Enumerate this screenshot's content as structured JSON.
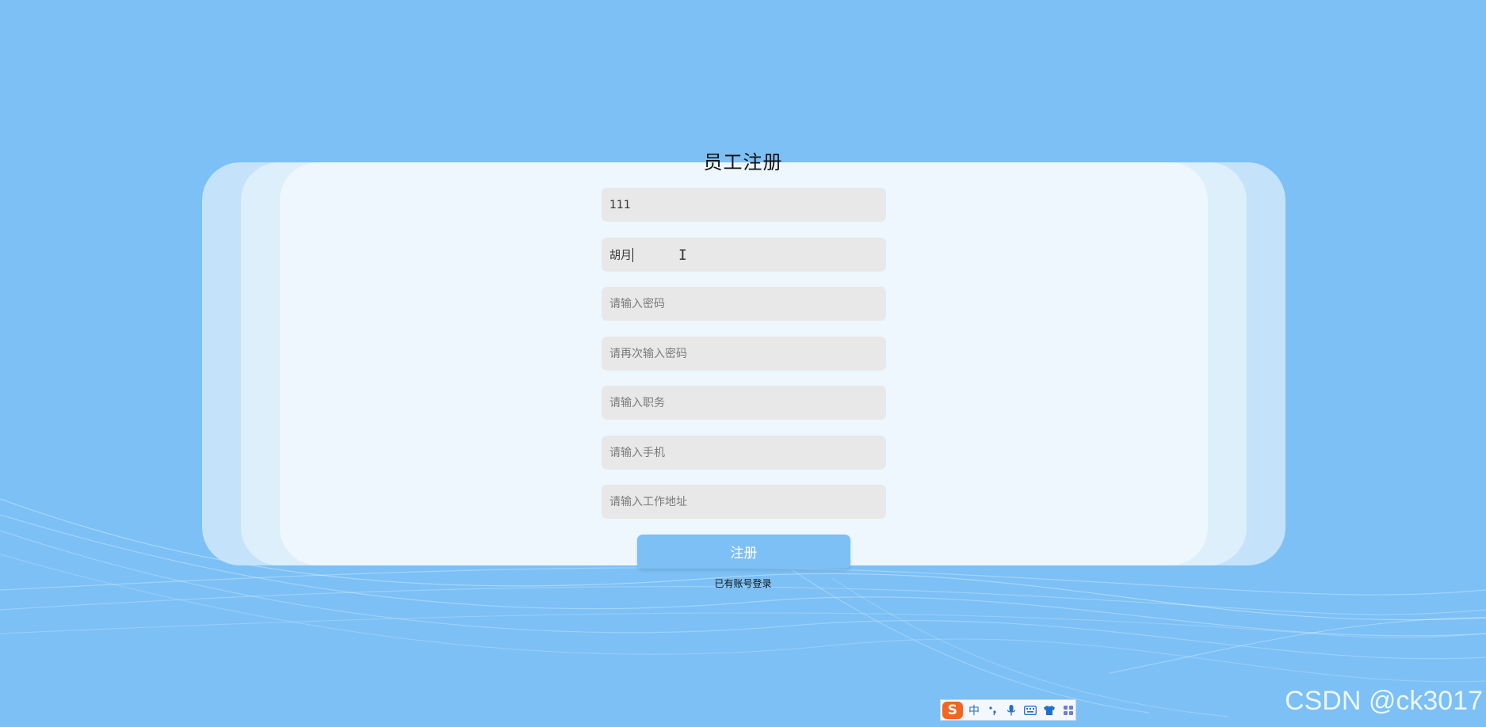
{
  "form": {
    "title": "员工注册",
    "fields": [
      {
        "name": "username",
        "value": "111",
        "placeholder": ""
      },
      {
        "name": "realname",
        "value": "胡月",
        "placeholder": ""
      },
      {
        "name": "password",
        "value": "",
        "placeholder": "请输入密码"
      },
      {
        "name": "password_confirm",
        "value": "",
        "placeholder": "请再次输入密码"
      },
      {
        "name": "position",
        "value": "",
        "placeholder": "请输入职务"
      },
      {
        "name": "phone",
        "value": "",
        "placeholder": "请输入手机"
      },
      {
        "name": "address",
        "value": "",
        "placeholder": "请输入工作地址"
      }
    ],
    "submit_label": "注册",
    "login_link": "已有账号登录"
  },
  "ime_toolbar": {
    "logo": "S",
    "mode": "中",
    "items": [
      "punctuation-icon",
      "microphone-icon",
      "keyboard-icon",
      "skin-icon",
      "toolbox-icon"
    ]
  },
  "watermark": "CSDN @ck3017",
  "colors": {
    "background": "#7cc0f5",
    "card_front": "#eef7fd",
    "input_bg": "#e8e8e8",
    "button": "#7cc0f5"
  }
}
